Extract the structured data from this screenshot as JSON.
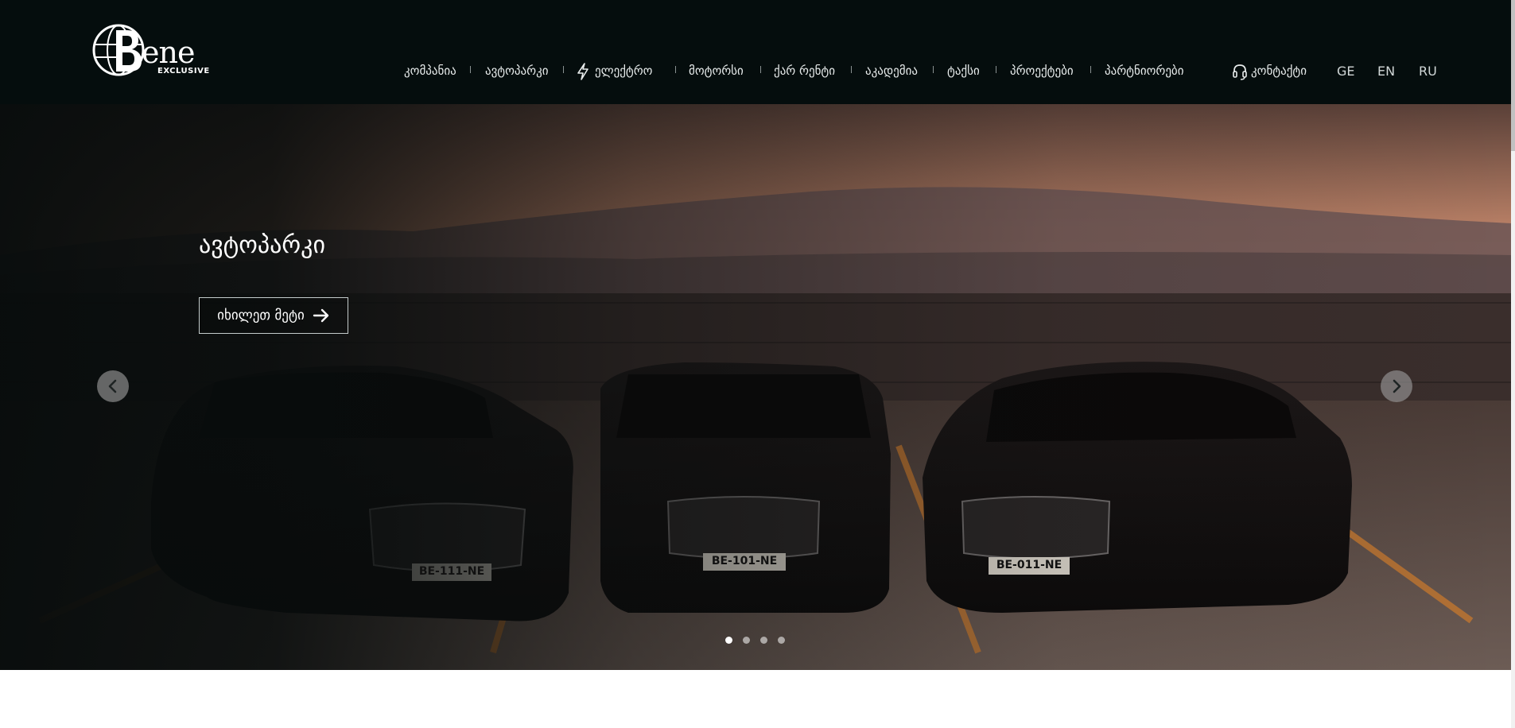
{
  "brand": {
    "logo_text": "ene",
    "logo_subtext": "EXCLUSIVE"
  },
  "nav": {
    "items": [
      {
        "label": "კომპანია",
        "icon": ""
      },
      {
        "label": "ავტოპარკი",
        "icon": ""
      },
      {
        "label": "ელექტრო",
        "icon": "lightning-icon"
      },
      {
        "label": "მოტორსი",
        "icon": ""
      },
      {
        "label": "ქარ რენტი",
        "icon": ""
      },
      {
        "label": "აკადემია",
        "icon": ""
      },
      {
        "label": "ტაქსი",
        "icon": ""
      },
      {
        "label": "პროექტები",
        "icon": ""
      },
      {
        "label": "პარტნიორები",
        "icon": ""
      }
    ],
    "contact_label": "კონტაქტი",
    "contact_icon": "headset-icon",
    "languages": [
      "GE",
      "EN",
      "RU"
    ]
  },
  "hero": {
    "title": "ავტოპარკი",
    "button_label": "იხილეთ მეტი",
    "button_icon": "arrow-right-icon",
    "prev_icon": "chevron-left-icon",
    "next_icon": "chevron-right-icon",
    "slide_count": 4,
    "active_slide": 1,
    "plates": [
      "BE-111-NE",
      "BE-101-NE",
      "BE-011-NE"
    ]
  },
  "colors": {
    "header_bg": "#050d0d",
    "text": "#e8ecec"
  }
}
